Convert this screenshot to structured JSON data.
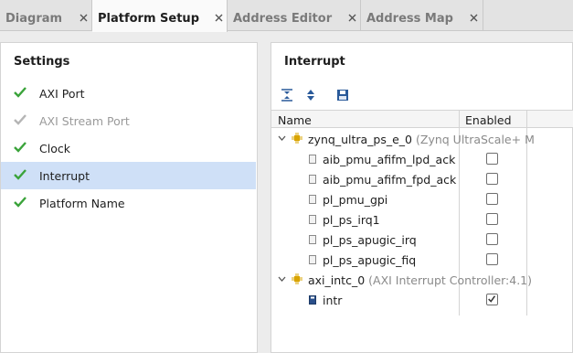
{
  "tabs": [
    {
      "label": "Diagram",
      "active": false
    },
    {
      "label": "Platform Setup",
      "active": true
    },
    {
      "label": "Address Editor",
      "active": false
    },
    {
      "label": "Address Map",
      "active": false
    }
  ],
  "settings": {
    "title": "Settings",
    "items": [
      {
        "label": "AXI Port",
        "state": "enabled"
      },
      {
        "label": "AXI Stream Port",
        "state": "disabled"
      },
      {
        "label": "Clock",
        "state": "enabled"
      },
      {
        "label": "Interrupt",
        "state": "selected"
      },
      {
        "label": "Platform Name",
        "state": "enabled"
      }
    ]
  },
  "interrupt": {
    "title": "Interrupt",
    "columns": {
      "name": "Name",
      "enabled": "Enabled"
    },
    "rows": [
      {
        "kind": "group",
        "name": "zynq_ultra_ps_e_0",
        "detail": "(Zynq UltraScale+ M"
      },
      {
        "kind": "item",
        "name": "aib_pmu_afifm_lpd_ack",
        "checked": false
      },
      {
        "kind": "item",
        "name": "aib_pmu_afifm_fpd_ack",
        "checked": false
      },
      {
        "kind": "item",
        "name": "pl_pmu_gpi",
        "checked": false
      },
      {
        "kind": "item",
        "name": "pl_ps_irq1",
        "checked": false
      },
      {
        "kind": "item",
        "name": "pl_ps_apugic_irq",
        "checked": false
      },
      {
        "kind": "item",
        "name": "pl_ps_apugic_fiq",
        "checked": false
      },
      {
        "kind": "group",
        "name": "axi_intc_0",
        "detail": "(AXI Interrupt Controller:4.1)"
      },
      {
        "kind": "item",
        "name": "intr",
        "checked": true
      }
    ]
  },
  "colors": {
    "check_green": "#3aa33a",
    "check_gray": "#b5b5b5",
    "selection": "#cfe0f7",
    "chip": "#d9a400"
  },
  "icons": [
    "close-icon",
    "check-icon",
    "collapse-all-icon",
    "expand-all-icon",
    "save-icon",
    "chevron-down-icon",
    "ip-block-icon",
    "port-icon"
  ]
}
